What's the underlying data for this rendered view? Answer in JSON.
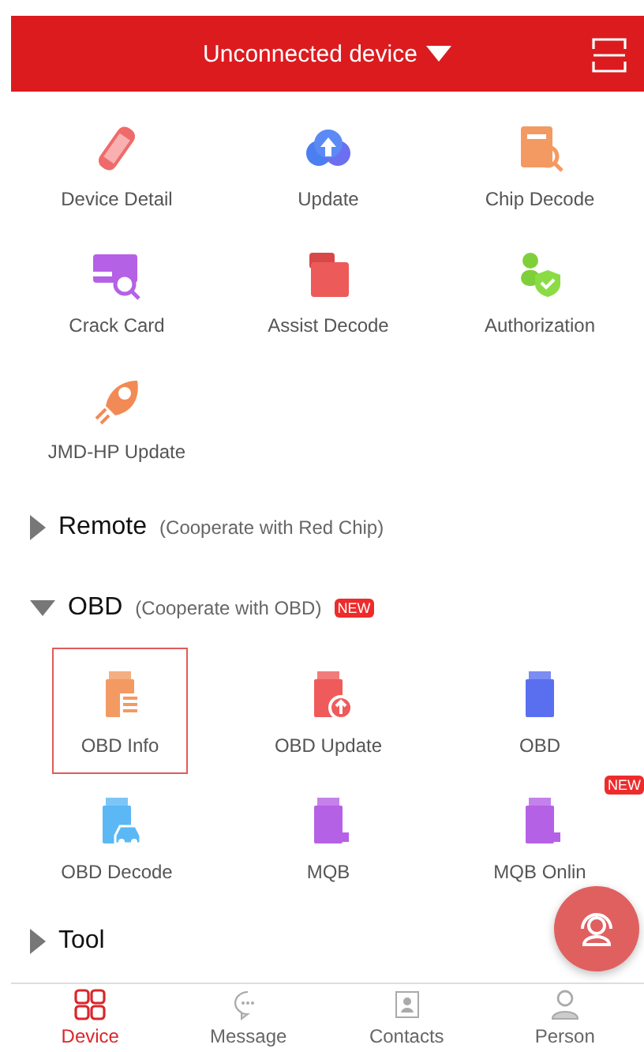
{
  "header": {
    "title": "Unconnected device"
  },
  "top_items": [
    {
      "label": "Device Detail",
      "selected": false
    },
    {
      "label": "Update",
      "selected": false
    },
    {
      "label": "Chip Decode",
      "selected": false
    },
    {
      "label": "Crack Card",
      "selected": false
    },
    {
      "label": "Assist Decode",
      "selected": false
    },
    {
      "label": "Authorization",
      "selected": false
    },
    {
      "label": "JMD-HP Update",
      "selected": false
    }
  ],
  "sections": [
    {
      "title": "Remote",
      "note": "(Cooperate with Red Chip)",
      "expanded": false
    },
    {
      "title": "OBD",
      "note": "(Cooperate with OBD)",
      "expanded": true,
      "badge": "NEW",
      "items": [
        {
          "label": "OBD Info",
          "selected": true
        },
        {
          "label": "OBD Update",
          "selected": false
        },
        {
          "label": "OBD",
          "selected": false
        },
        {
          "label": "OBD Decode",
          "selected": false
        },
        {
          "label": "MQB",
          "selected": false
        },
        {
          "label": "MQB Onlin",
          "selected": false,
          "badge": "NEW"
        }
      ]
    },
    {
      "title": "Tool",
      "expanded": false
    }
  ],
  "nav": [
    {
      "label": "Device",
      "selected": true
    },
    {
      "label": "Message",
      "selected": false
    },
    {
      "label": "Contacts",
      "selected": false
    },
    {
      "label": "Person",
      "selected": false
    }
  ]
}
